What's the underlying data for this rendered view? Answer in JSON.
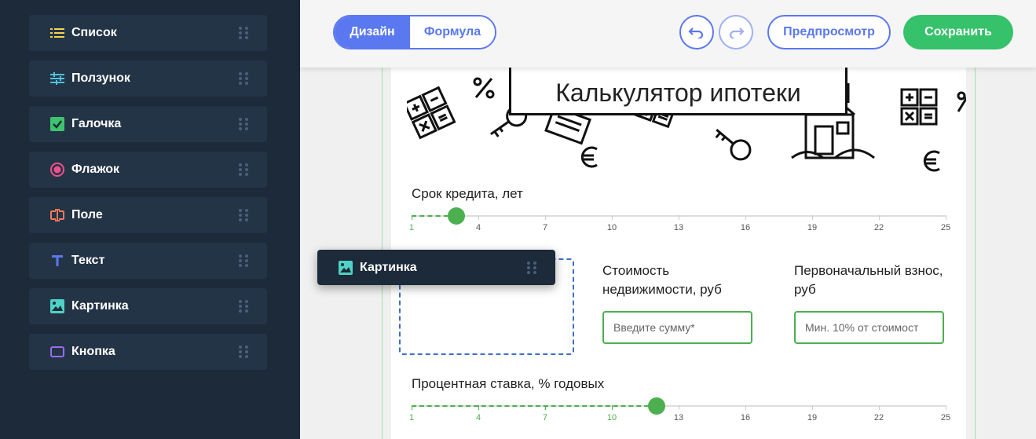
{
  "sidebar": {
    "items": [
      {
        "label": "Список",
        "icon": "list-icon",
        "color": "#f5d547"
      },
      {
        "label": "Ползунок",
        "icon": "slider-icon",
        "color": "#4fc3d9"
      },
      {
        "label": "Галочка",
        "icon": "checkbox-icon",
        "color": "#3ec46d"
      },
      {
        "label": "Флажок",
        "icon": "radio-icon",
        "color": "#f0508a"
      },
      {
        "label": "Поле",
        "icon": "text-field-icon",
        "color": "#f07a5a"
      },
      {
        "label": "Текст",
        "icon": "text-icon",
        "color": "#5a78f0"
      },
      {
        "label": "Картинка",
        "icon": "image-icon",
        "color": "#4fd1c5"
      },
      {
        "label": "Кнопка",
        "icon": "button-icon",
        "color": "#9a6cf0"
      }
    ]
  },
  "toolbar": {
    "design_label": "Дизайн",
    "formula_label": "Формула",
    "preview_label": "Предпросмотр",
    "save_label": "Сохранить"
  },
  "form": {
    "title": "Калькулятор ипотеки",
    "term_label": "Срок кредита, лет",
    "term_value": 3,
    "price_label_1": "Стоимость",
    "price_label_2": "недвижимости, руб",
    "price_placeholder": "Введите сумму*",
    "down_label_1": "Первоначальный взнос,",
    "down_label_2": "руб",
    "down_placeholder": "Мин. 10% от стоимост",
    "rate_label": "Процентная ставка, % годовых",
    "rate_value": 12
  },
  "slider_ticks": [
    "1",
    "4",
    "7",
    "10",
    "13",
    "16",
    "19",
    "22",
    "25"
  ],
  "dragging": {
    "label": "Картинка",
    "icon": "image-icon"
  },
  "colors": {
    "accent": "#5a78f0",
    "success": "#35c26a",
    "slider": "#4caf50",
    "sidebar": "#1c2a3a"
  }
}
